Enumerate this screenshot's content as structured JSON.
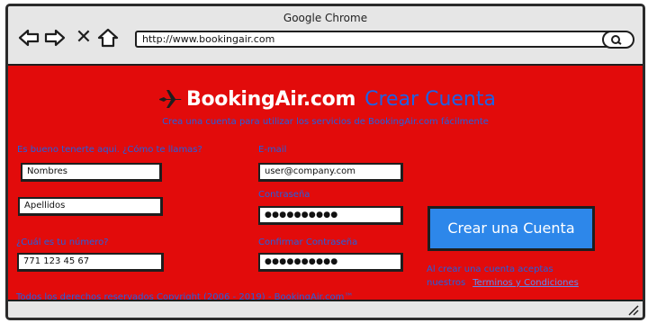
{
  "window": {
    "title": "Google Chrome",
    "url": "http://www.bookingair.com"
  },
  "icons": {
    "back": "back-arrow-icon",
    "forward": "forward-arrow-icon",
    "stop": "close-icon",
    "home": "home-icon",
    "search": "search-icon",
    "brand": "plane-icon",
    "grip": "resize-grip-icon"
  },
  "brand": {
    "name": "BookingAir.com",
    "page_title": "Crear Cuenta",
    "subtitle": "Crea una cuenta para utilizar los servicios de BookingAir.com fácilmente"
  },
  "form": {
    "name_prompt": "Es bueno tenerte aqui. ¿Cómo te llamas?",
    "first_name_value": "Nombres",
    "last_name_value": "Apellidos",
    "phone_label": "¿Cuál es tu número?",
    "phone_value": "771 123 45 67",
    "email_label": "E-mail",
    "email_value": "user@company.com",
    "password_label": "Contraseña",
    "password_value": "●●●●●●●●●●",
    "confirm_label": "Confirmar Contraseña",
    "confirm_value": "●●●●●●●●●●"
  },
  "cta": {
    "label": "Crear una Cuenta",
    "terms_line1": "Al crear una cuenta aceptas",
    "terms_line2": "nuestros",
    "terms_link": "Terminos y Condiciones"
  },
  "footer": {
    "copyright": "Todos los derechos reservados Copyright (2006 - 2019) - BookingAir.com™"
  },
  "colors": {
    "page_bg": "#e20b0b",
    "accent_text": "#1d62e6",
    "button_bg": "#2d87ea",
    "chrome_bg": "#e6e6e6"
  }
}
